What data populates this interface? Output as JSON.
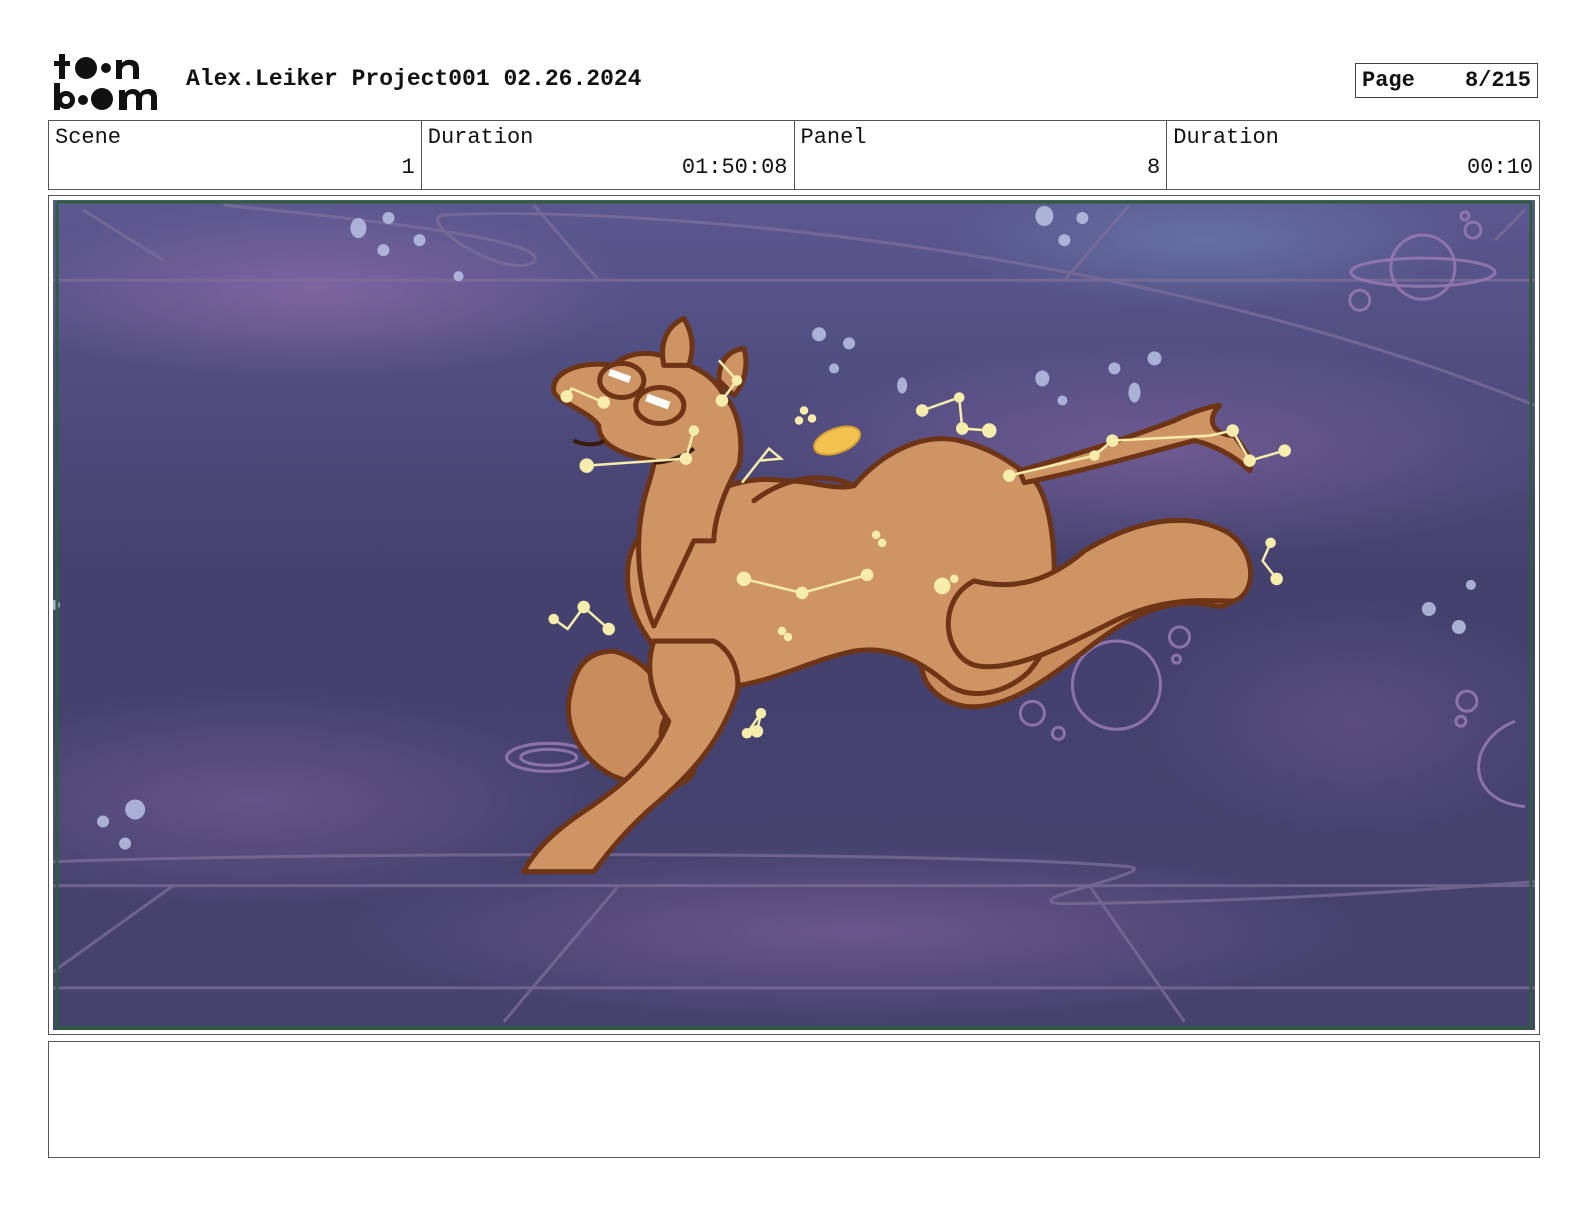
{
  "header": {
    "logo_text": "toon boom",
    "project_title": "Alex.Leiker Project001 02.26.2024",
    "page_label": "Page",
    "page_value": "8/215"
  },
  "info": {
    "scene_label": "Scene",
    "scene_value": "1",
    "scene_duration_label": "Duration",
    "scene_duration_value": "01:50:08",
    "panel_label": "Panel",
    "panel_value": "8",
    "panel_duration_label": "Duration",
    "panel_duration_value": "00:10"
  },
  "notes": {
    "text": ""
  },
  "colors": {
    "sky_dark": "#3f3f68",
    "sky_purple": "#6a5a94",
    "camel_fill": "#cf9464",
    "camel_outline": "#6e3416",
    "constellation": "#f6ecab",
    "frame_green": "#2f5e3c"
  }
}
